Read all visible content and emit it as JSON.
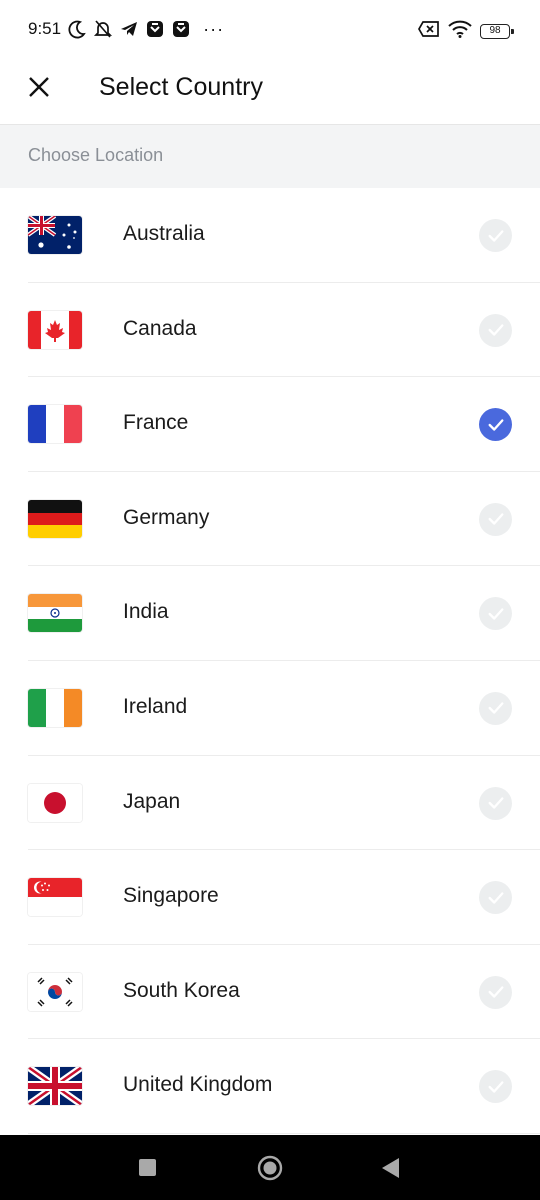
{
  "status_bar": {
    "time": "9:51",
    "left_icons": [
      "moon-icon",
      "bell-off-icon",
      "telegram-icon",
      "app-badge-icon",
      "app-badge-icon"
    ],
    "more": "···",
    "right_icons": [
      "no-sim-icon",
      "wifi-icon"
    ],
    "battery": "98"
  },
  "app_bar": {
    "close_icon": "close-icon",
    "title": "Select Country"
  },
  "section": {
    "label": "Choose Location"
  },
  "countries": [
    {
      "name": "Australia",
      "flag": "australia-flag",
      "selected": false
    },
    {
      "name": "Canada",
      "flag": "canada-flag",
      "selected": false
    },
    {
      "name": "France",
      "flag": "france-flag",
      "selected": true
    },
    {
      "name": "Germany",
      "flag": "germany-flag",
      "selected": false
    },
    {
      "name": "India",
      "flag": "india-flag",
      "selected": false
    },
    {
      "name": "Ireland",
      "flag": "ireland-flag",
      "selected": false
    },
    {
      "name": "Japan",
      "flag": "japan-flag",
      "selected": false
    },
    {
      "name": "Singapore",
      "flag": "singapore-flag",
      "selected": false
    },
    {
      "name": "South Korea",
      "flag": "south-korea-flag",
      "selected": false
    },
    {
      "name": "United Kingdom",
      "flag": "united-kingdom-flag",
      "selected": false
    }
  ],
  "colors": {
    "accent": "#4a69dd",
    "unselected_check": "#eceeef",
    "section_bg": "#f3f4f5",
    "section_text": "#8a8f96"
  }
}
